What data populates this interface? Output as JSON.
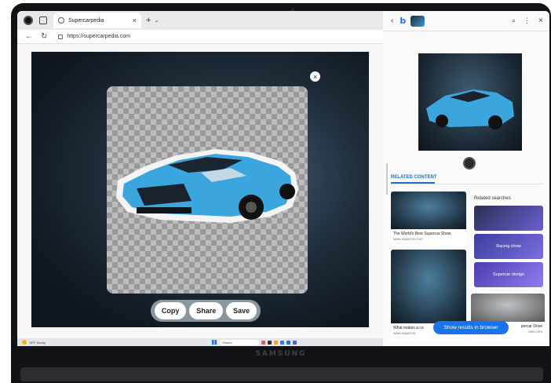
{
  "browser": {
    "tab_title": "Supercarpedia",
    "url": "https://supercarpedia.com",
    "actions": {
      "copy": "Copy",
      "share": "Share",
      "save": "Save"
    }
  },
  "taskbar": {
    "temp": "78°F",
    "weather": "Sunny",
    "search": "Search"
  },
  "panel": {
    "related_heading": "RELATED CONTENT",
    "related_searches_heading": "Related searches",
    "cards": [
      {
        "title": "The World's Best Supercar Show",
        "source": "www.supercar.com"
      },
      {
        "title": "What makes a ca",
        "source": "www.supercar"
      },
      {
        "title": "percar Drive",
        "source": "ews.com"
      }
    ],
    "searches": [
      "Racing show",
      "Supercar design"
    ],
    "cta": "Show results in browser"
  },
  "device": {
    "brand": "SAMSUNG"
  },
  "colors": {
    "accent": "#1a73e8",
    "car": "#3aa6dd"
  }
}
